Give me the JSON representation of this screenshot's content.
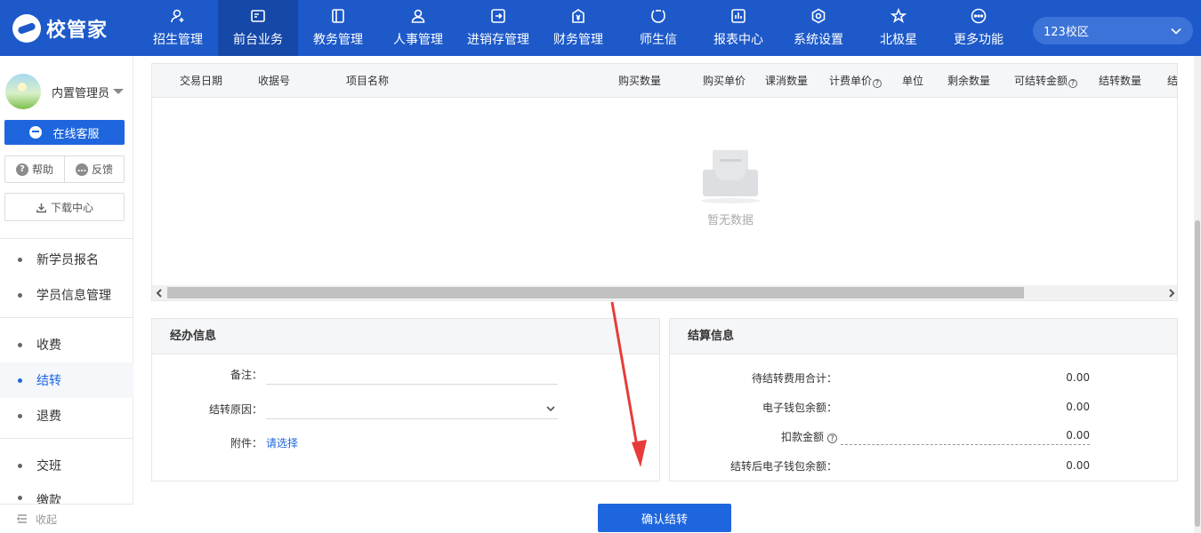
{
  "app": {
    "logo_text": "校管家",
    "campus": "123校区"
  },
  "nav": [
    {
      "label": "招生管理",
      "icon": "user-add-icon",
      "active": false
    },
    {
      "label": "前台业务",
      "icon": "desk-icon",
      "active": true
    },
    {
      "label": "教务管理",
      "icon": "book-icon",
      "active": false
    },
    {
      "label": "人事管理",
      "icon": "person-icon",
      "active": false
    },
    {
      "label": "进销存管理",
      "icon": "inventory-icon",
      "active": false
    },
    {
      "label": "财务管理",
      "icon": "finance-icon",
      "active": false
    },
    {
      "label": "师生信",
      "icon": "message-icon",
      "active": false
    },
    {
      "label": "报表中心",
      "icon": "report-icon",
      "active": false
    },
    {
      "label": "系统设置",
      "icon": "settings-icon",
      "active": false
    },
    {
      "label": "北极星",
      "icon": "star-icon",
      "active": false
    },
    {
      "label": "更多功能",
      "icon": "more-icon",
      "active": false
    }
  ],
  "sidebar": {
    "user_name": "内置管理员",
    "service_label": "在线客服",
    "help_label": "帮助",
    "feedback_label": "反馈",
    "download_label": "下载中心",
    "menu": [
      {
        "label": "新学员报名",
        "active": false
      },
      {
        "label": "学员信息管理",
        "active": false
      },
      {
        "label": "收费",
        "active": false
      },
      {
        "label": "结转",
        "active": true
      },
      {
        "label": "退费",
        "active": false
      },
      {
        "label": "交班",
        "active": false
      },
      {
        "label": "缴款",
        "active": false
      }
    ],
    "collapse_label": "收起"
  },
  "table": {
    "columns": [
      "交易日期",
      "收据号",
      "项目名称",
      "购买数量",
      "购买单价",
      "课消数量",
      "计费单价",
      "单位",
      "剩余数量",
      "可结转金额",
      "结转数量",
      "结"
    ],
    "empty_text": "暂无数据"
  },
  "handling": {
    "title": "经办信息",
    "remark_label": "备注：",
    "reason_label": "结转原因：",
    "attachment_label": "附件：",
    "attachment_link": "请选择"
  },
  "settlement": {
    "title": "结算信息",
    "rows": [
      {
        "label": "待结转费用合计：",
        "value": "0.00"
      },
      {
        "label": "电子钱包余额：",
        "value": "0.00"
      },
      {
        "label": "扣款金额",
        "value": "0.00"
      },
      {
        "label": "结转后电子钱包余额：",
        "value": "0.00"
      }
    ]
  },
  "actions": {
    "confirm_label": "确认结转"
  },
  "colors": {
    "nav_bg": "#1d59c9",
    "nav_active": "#1548a8",
    "primary": "#1e66dd",
    "annotation_arrow": "#e83b3b"
  }
}
